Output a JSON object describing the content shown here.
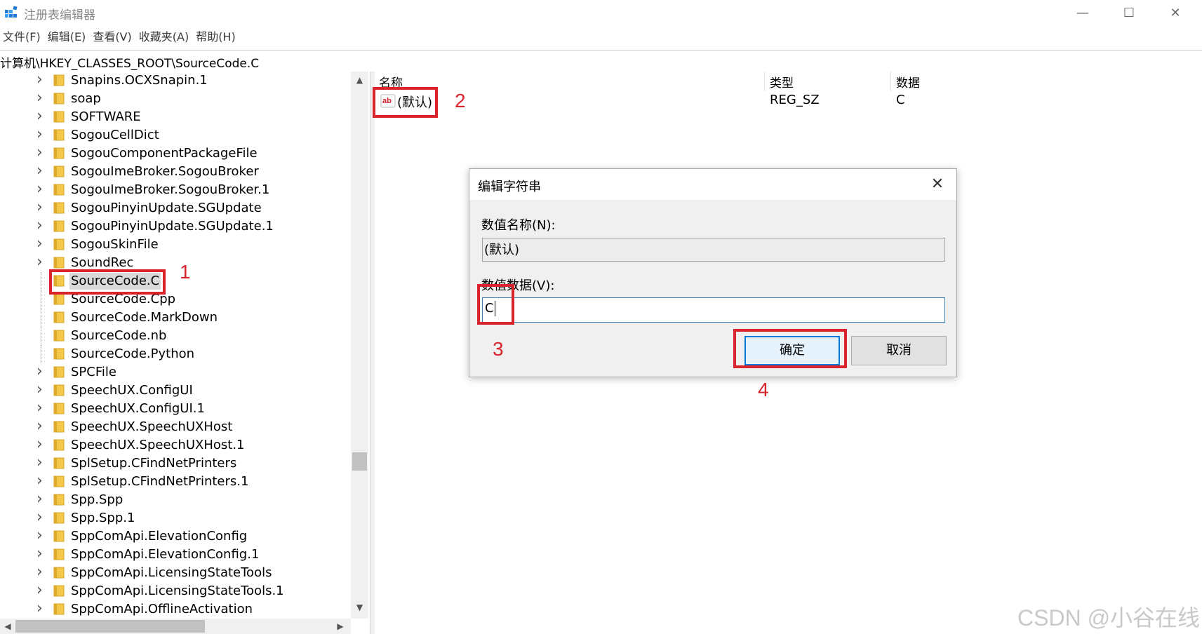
{
  "window": {
    "title": "注册表编辑器",
    "minimize_glyph": "—",
    "maximize_glyph": "☐",
    "close_glyph": "✕"
  },
  "menu": [
    "文件(F)",
    "编辑(E)",
    "查看(V)",
    "收藏夹(A)",
    "帮助(H)"
  ],
  "address": "计算机\\HKEY_CLASSES_ROOT\\SourceCode.C",
  "tree": {
    "items": [
      {
        "label": "Snapins.OCXSnapin.1",
        "expandable": true
      },
      {
        "label": "soap",
        "expandable": true
      },
      {
        "label": "SOFTWARE",
        "expandable": true
      },
      {
        "label": "SogouCellDict",
        "expandable": true
      },
      {
        "label": "SogouComponentPackageFile",
        "expandable": true
      },
      {
        "label": "SogouImeBroker.SogouBroker",
        "expandable": true
      },
      {
        "label": "SogouImeBroker.SogouBroker.1",
        "expandable": true
      },
      {
        "label": "SogouPinyinUpdate.SGUpdate",
        "expandable": true
      },
      {
        "label": "SogouPinyinUpdate.SGUpdate.1",
        "expandable": true
      },
      {
        "label": "SogouSkinFile",
        "expandable": true
      },
      {
        "label": "SoundRec",
        "expandable": true
      },
      {
        "label": "SourceCode.C",
        "expandable": false,
        "selected": true
      },
      {
        "label": "SourceCode.Cpp",
        "expandable": false
      },
      {
        "label": "SourceCode.MarkDown",
        "expandable": false
      },
      {
        "label": "SourceCode.nb",
        "expandable": false
      },
      {
        "label": "SourceCode.Python",
        "expandable": false
      },
      {
        "label": "SPCFile",
        "expandable": true
      },
      {
        "label": "SpeechUX.ConfigUI",
        "expandable": true
      },
      {
        "label": "SpeechUX.ConfigUI.1",
        "expandable": true
      },
      {
        "label": "SpeechUX.SpeechUXHost",
        "expandable": true
      },
      {
        "label": "SpeechUX.SpeechUXHost.1",
        "expandable": true
      },
      {
        "label": "SplSetup.CFindNetPrinters",
        "expandable": true
      },
      {
        "label": "SplSetup.CFindNetPrinters.1",
        "expandable": true
      },
      {
        "label": "Spp.Spp",
        "expandable": true
      },
      {
        "label": "Spp.Spp.1",
        "expandable": true
      },
      {
        "label": "SppComApi.ElevationConfig",
        "expandable": true
      },
      {
        "label": "SppComApi.ElevationConfig.1",
        "expandable": true
      },
      {
        "label": "SppComApi.LicensingStateTools",
        "expandable": true
      },
      {
        "label": "SppComApi.LicensingStateTools.1",
        "expandable": true
      },
      {
        "label": "SppComApi.OfflineActivation",
        "expandable": true
      }
    ]
  },
  "values": {
    "headers": {
      "name": "名称",
      "type": "类型",
      "data": "数据"
    },
    "rows": [
      {
        "icon": "string-value-icon",
        "name": "(默认)",
        "type": "REG_SZ",
        "data": "C"
      }
    ]
  },
  "dialog": {
    "title": "编辑字符串",
    "close_glyph": "✕",
    "name_label": "数值名称(N):",
    "name_value": "(默认)",
    "data_label": "数值数据(V):",
    "data_value": "C",
    "ok_label": "确定",
    "cancel_label": "取消"
  },
  "annotations": {
    "color": "#d9232d",
    "labels": [
      "1",
      "2",
      "3",
      "4"
    ]
  },
  "watermark": "CSDN @小谷在线"
}
